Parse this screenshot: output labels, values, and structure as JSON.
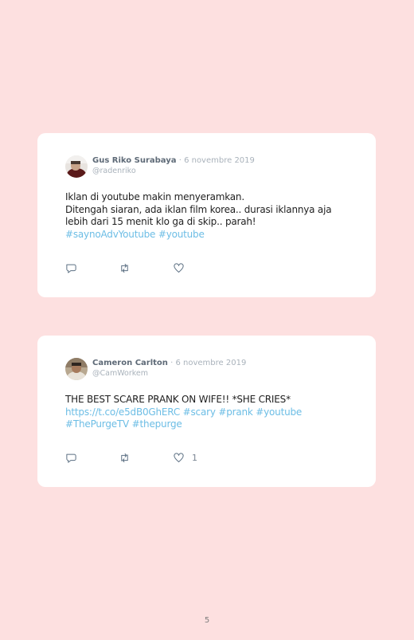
{
  "tweets": [
    {
      "name": "Gus Riko Surabaya",
      "separator": "·",
      "date": "6 novembre 2019",
      "handle": "@radenriko",
      "lines": [
        "Iklan di youtube makin menyeramkan.",
        "Ditengah siaran, ada iklan film korea.. durasi iklannya aja",
        "lebih dari 15 menit klo ga di skip.. parah!"
      ],
      "tags_line": "#saynoAdvYoutube #youtube",
      "like_count": ""
    },
    {
      "name": "Cameron Carlton",
      "separator": "·",
      "date": "6 novembre 2019",
      "handle": "@CamWorkem",
      "lines": [
        "THE BEST SCARE PRANK ON WIFE!! *SHE CRIES*"
      ],
      "link_line": "https://t.co/e5dB0GhERC #scary #prank #youtube",
      "tags_line": "#ThePurgeTV #thepurge",
      "like_count": "1"
    }
  ],
  "page_number": "5",
  "colors": {
    "background": "#fde0e0",
    "card": "#ffffff",
    "hashtag": "#6cbde5",
    "icon": "#5b6f82"
  },
  "icons": [
    "reply-icon",
    "retweet-icon",
    "heart-icon"
  ]
}
